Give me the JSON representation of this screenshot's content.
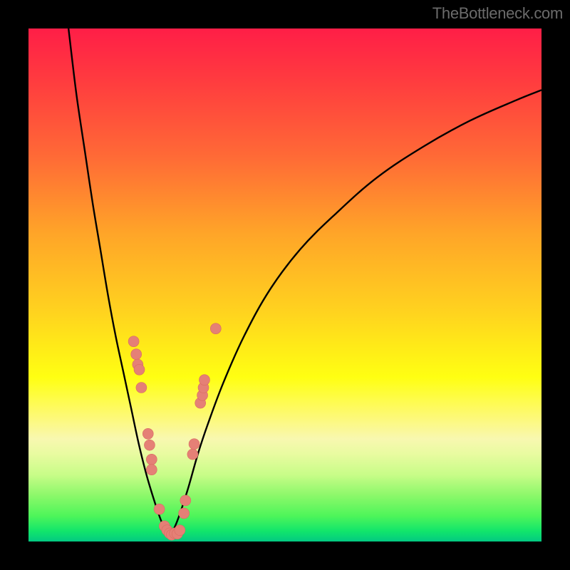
{
  "watermark": "TheBottleneck.com",
  "colors": {
    "frame": "#000000",
    "curve": "#000000",
    "point_fill": "#e58076",
    "point_stroke": "#d86b61"
  },
  "chart_data": {
    "type": "line",
    "title": "",
    "xlabel": "",
    "ylabel": "",
    "xlim": [
      0,
      100
    ],
    "ylim": [
      0,
      100
    ],
    "grid": false,
    "legend": false,
    "series": [
      {
        "name": "left-branch",
        "x": [
          7.8,
          8.5,
          9.5,
          11,
          12.5,
          14,
          15.5,
          17,
          18.5,
          20,
          21.5,
          23,
          24.5,
          25.5,
          26.5,
          27.5
        ],
        "y": [
          100,
          94,
          86,
          76,
          66,
          57,
          48,
          40,
          33,
          26,
          19,
          13,
          8,
          5,
          2.5,
          0.8
        ]
      },
      {
        "name": "right-branch",
        "x": [
          27.5,
          29,
          31,
          33,
          35,
          38,
          42,
          47,
          53,
          60,
          68,
          77,
          86,
          95,
          100
        ],
        "y": [
          0.8,
          4,
          10,
          17,
          23,
          31,
          40,
          49,
          57,
          64,
          71,
          77,
          82,
          86,
          88
        ]
      }
    ],
    "points": [
      {
        "x": 20.5,
        "y": 39.0
      },
      {
        "x": 21.0,
        "y": 36.5
      },
      {
        "x": 21.3,
        "y": 34.5
      },
      {
        "x": 21.6,
        "y": 33.5
      },
      {
        "x": 22.0,
        "y": 30.0
      },
      {
        "x": 23.3,
        "y": 21.0
      },
      {
        "x": 23.6,
        "y": 18.8
      },
      {
        "x": 24.0,
        "y": 16.0
      },
      {
        "x": 24.0,
        "y": 14.0
      },
      {
        "x": 25.5,
        "y": 6.3
      },
      {
        "x": 26.5,
        "y": 3.0
      },
      {
        "x": 27.0,
        "y": 2.2
      },
      {
        "x": 27.5,
        "y": 1.6
      },
      {
        "x": 27.9,
        "y": 1.3
      },
      {
        "x": 28.5,
        "y": 1.6
      },
      {
        "x": 29.0,
        "y": 1.5
      },
      {
        "x": 29.5,
        "y": 2.2
      },
      {
        "x": 30.3,
        "y": 5.5
      },
      {
        "x": 30.6,
        "y": 8.0
      },
      {
        "x": 32.0,
        "y": 17.0
      },
      {
        "x": 32.3,
        "y": 19.0
      },
      {
        "x": 33.5,
        "y": 27.0
      },
      {
        "x": 33.9,
        "y": 28.5
      },
      {
        "x": 34.1,
        "y": 30.0
      },
      {
        "x": 34.3,
        "y": 31.5
      },
      {
        "x": 36.5,
        "y": 41.5
      }
    ]
  }
}
